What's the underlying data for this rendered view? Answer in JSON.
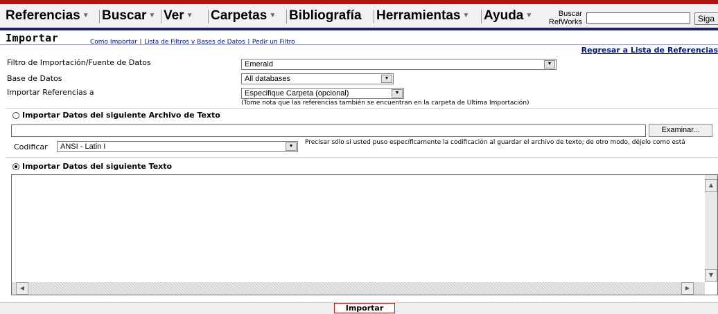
{
  "menu": {
    "items": [
      {
        "label": "Referencias",
        "dropdown": true
      },
      {
        "label": "Buscar",
        "dropdown": true
      },
      {
        "label": "Ver",
        "dropdown": true
      },
      {
        "label": "Carpetas",
        "dropdown": true
      },
      {
        "label": "Bibliografía",
        "dropdown": false
      },
      {
        "label": "Herramientas",
        "dropdown": true
      },
      {
        "label": "Ayuda",
        "dropdown": true
      }
    ],
    "search_label_1": "Buscar",
    "search_label_2": "RefWorks",
    "search_button": "Siga"
  },
  "header": {
    "title": "Importar",
    "links": [
      "Como Importar",
      "Lista de Filtros y Bases de Datos",
      "Pedir un Filtro"
    ],
    "link_separator": "|",
    "back_link": "Regresar a Lista de Referencias"
  },
  "form": {
    "filter_label": "Filtro de Importación/Fuente de Datos",
    "filter_value": "Emerald",
    "database_label": "Base de Datos",
    "database_value": "All databases",
    "import_to_label": "Importar Referencias a",
    "import_to_value": "Especifique Carpeta (opcional)",
    "import_to_note": "(Tome nota que las referencias también se encuentran en la carpeta de Ultima Importación)"
  },
  "file_section": {
    "title": "Importar Datos del siguiente Archivo de Texto",
    "selected": false,
    "browse_button": "Examinar...",
    "encoding_label": "Codificar",
    "encoding_value": "ANSI - Latin I",
    "encoding_note": "Precisar sólo si usted puso específicamente la codificación al guardar el archivo de texto; de otro modo, déjelo como está"
  },
  "text_section": {
    "title": "Importar Datos del siguiente Texto",
    "selected": true
  },
  "footer": {
    "import_button": "Importar"
  },
  "colors": {
    "accent_red": "#b01010",
    "navy": "#1a1f6b",
    "link": "#00148c"
  }
}
